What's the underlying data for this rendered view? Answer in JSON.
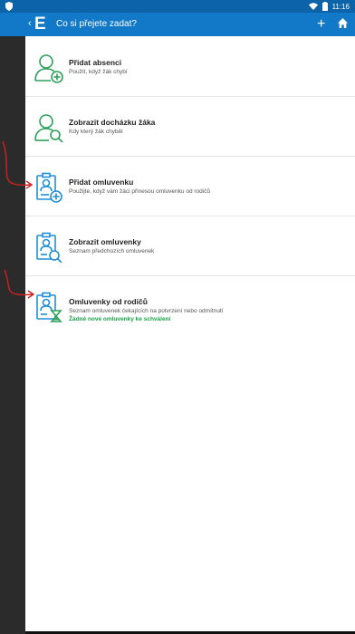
{
  "status_bar": {
    "time": "11:16"
  },
  "app_bar": {
    "logo": "E",
    "title": "Co si přejete zadat?",
    "add_icon": "plus-icon",
    "home_icon": "home-icon"
  },
  "menu": [
    {
      "title": "Přidat absenci",
      "subtitle": "Použít, když žák chybí",
      "icon": "person-add-icon",
      "color": "#2ea05a"
    },
    {
      "title": "Zobrazit docházku žáka",
      "subtitle": "Kdy který žák chyběl",
      "icon": "person-search-icon",
      "color": "#2ea05a"
    },
    {
      "title": "Přidat omluvenku",
      "subtitle": "Použijte, když vám žáci přinesou omluvenku od rodičů",
      "icon": "badge-add-icon",
      "color": "#1f8fd6"
    },
    {
      "title": "Zobrazit omluvenky",
      "subtitle": "Seznam předchozích omluvenek",
      "icon": "badge-search-icon",
      "color": "#1f8fd6"
    },
    {
      "title": "Omluvenky od rodičů",
      "subtitle": "Seznam omluvenek čekajících na potvrzení nebo odmítnutí",
      "status": "Žádné nové omluvenky ke schválení",
      "icon": "badge-hourglass-icon",
      "color": "#1f8fd6",
      "status_color": "#1aa34a"
    }
  ],
  "annotations": {
    "arrow_color": "#d12020"
  }
}
